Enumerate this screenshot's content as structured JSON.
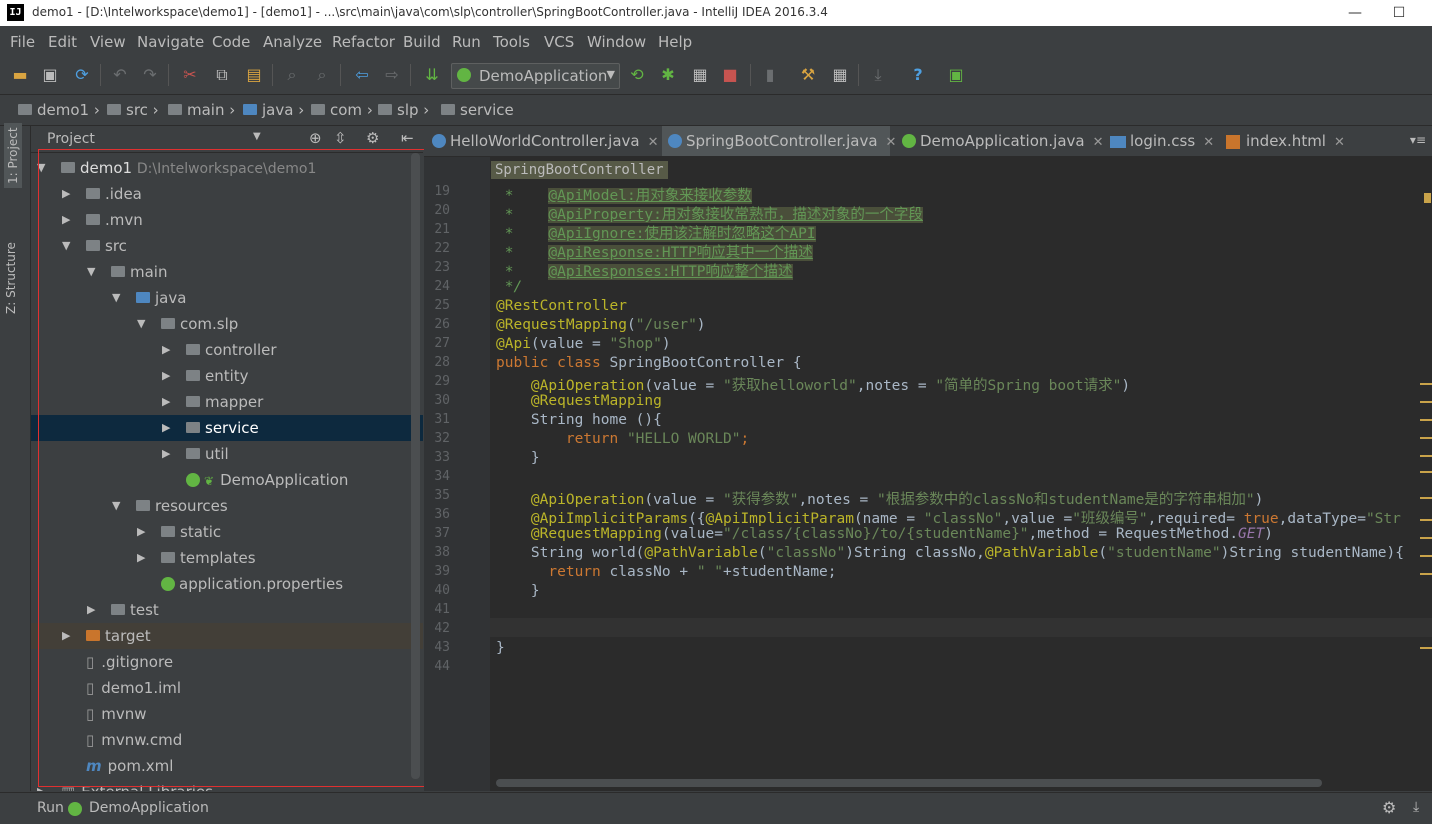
{
  "window": {
    "title": "demo1 - [D:\\Intelworkspace\\demo1] - [demo1] - ...\\src\\main\\java\\com\\slp\\controller\\SpringBootController.java - IntelliJ IDEA 2016.3.4",
    "logo": "IJ"
  },
  "menu": [
    "File",
    "Edit",
    "View",
    "Navigate",
    "Code",
    "Analyze",
    "Refactor",
    "Build",
    "Run",
    "Tools",
    "VCS",
    "Window",
    "Help"
  ],
  "toolbar": {
    "run_config": "DemoApplication"
  },
  "breadcrumb": [
    "demo1",
    "src",
    "main",
    "java",
    "com",
    "slp",
    "service"
  ],
  "side_tabs": {
    "project": "1: Project",
    "structure": "Z: Structure"
  },
  "project_panel": {
    "title": "Project",
    "tree": [
      {
        "label": "demo1",
        "path": "D:\\Intelworkspace\\demo1"
      },
      {
        "label": ".idea"
      },
      {
        "label": ".mvn"
      },
      {
        "label": "src"
      },
      {
        "label": "main"
      },
      {
        "label": "java"
      },
      {
        "label": "com.slp"
      },
      {
        "label": "controller"
      },
      {
        "label": "entity"
      },
      {
        "label": "mapper"
      },
      {
        "label": "service"
      },
      {
        "label": "util"
      },
      {
        "label": "DemoApplication"
      },
      {
        "label": "resources"
      },
      {
        "label": "static"
      },
      {
        "label": "templates"
      },
      {
        "label": "application.properties"
      },
      {
        "label": "test"
      },
      {
        "label": "target"
      },
      {
        "label": ".gitignore"
      },
      {
        "label": "demo1.iml"
      },
      {
        "label": "mvnw"
      },
      {
        "label": "mvnw.cmd"
      },
      {
        "label": "pom.xml"
      },
      {
        "label": "External Libraries"
      }
    ]
  },
  "editor_tabs": [
    {
      "label": "HelloWorldController.java"
    },
    {
      "label": "SpringBootController.java"
    },
    {
      "label": "DemoApplication.java"
    },
    {
      "label": "login.css"
    },
    {
      "label": "index.html"
    }
  ],
  "editor": {
    "sticky_header": "SpringBootController",
    "line_numbers": [
      "19",
      "20",
      "21",
      "22",
      "23",
      "24",
      "25",
      "26",
      "27",
      "28",
      "29",
      "30",
      "31",
      "32",
      "33",
      "34",
      "35",
      "36",
      "37",
      "38",
      "39",
      "40",
      "41",
      "42",
      "43",
      "44"
    ],
    "comment_lines": [
      {
        "prefix": " *    ",
        "tag": "@ApiModel:",
        "text": "用对象来接收参数"
      },
      {
        "prefix": " *    ",
        "tag": "@ApiProperty:",
        "text": "用对象接收常熟市，描述对象的一个字段"
      },
      {
        "prefix": " *    ",
        "tag": "@ApiIgnore:",
        "text": "使用该注解时忽略这个API"
      },
      {
        "prefix": " *    ",
        "tag": "@ApiResponse:HTTP",
        "text": "响应其中一个描述"
      },
      {
        "prefix": " *    ",
        "tag": "@ApiResponses:HTTP",
        "text": "响应整个描述"
      }
    ],
    "comment_end": " */",
    "code": {
      "l25": "@RestController",
      "l26a": "@RequestMapping",
      "l26b": "(",
      "l26c": "\"/user\"",
      "l26d": ")",
      "l27a": "@Api",
      "l27b": "(value = ",
      "l27c": "\"Shop\"",
      "l27d": ")",
      "l28a": "public class ",
      "l28b": "SpringBootController {",
      "l29a": "    @ApiOperation",
      "l29b": "(value = ",
      "l29c": "\"获取helloworld\"",
      "l29d": ",notes = ",
      "l29e": "\"简单的Spring boot请求\"",
      "l29f": ")",
      "l30": "    @RequestMapping",
      "l31": "    String home (){",
      "l32a": "        return ",
      "l32b": "\"HELLO WORLD\"",
      "l32c": ";",
      "l33": "    }",
      "l35a": "    @ApiOperation",
      "l35b": "(value = ",
      "l35c": "\"获得参数\"",
      "l35d": ",notes = ",
      "l35e": "\"根据参数中的classNo和studentName是的字符串相加\"",
      "l35f": ")",
      "l36a": "    @ApiImplicitParams",
      "l36b": "({",
      "l36c": "@ApiImplicitParam",
      "l36d": "(name = ",
      "l36e": "\"classNo\"",
      "l36f": ",value =",
      "l36g": "\"班级编号\"",
      "l36h": ",required= ",
      "l36i": "true",
      "l36j": ",dataType=",
      "l36k": "\"Str",
      "l37a": "    @RequestMapping",
      "l37b": "(value=",
      "l37c": "\"/class/{classNo}/to/{studentName}\"",
      "l37d": ",method = RequestMethod.",
      "l37e": "GET",
      "l37f": ")",
      "l38a": "    String world(",
      "l38b": "@PathVariable",
      "l38c": "(",
      "l38d": "\"classNo\"",
      "l38e": ")String classNo,",
      "l38f": "@PathVariable",
      "l38g": "(",
      "l38h": "\"studentName\"",
      "l38i": ")String studentName){",
      "l39a": "      return ",
      "l39b": "classNo + ",
      "l39c": "\" \"",
      "l39d": "+studentName;",
      "l40": "    }",
      "l43": "}"
    }
  },
  "statusbar": {
    "label": "Run",
    "config": "DemoApplication"
  },
  "colors": {
    "selection": "#0d293e",
    "highlight_box": "#e03030",
    "background": "#3c3f41",
    "editor_bg": "#2b2b2b"
  }
}
